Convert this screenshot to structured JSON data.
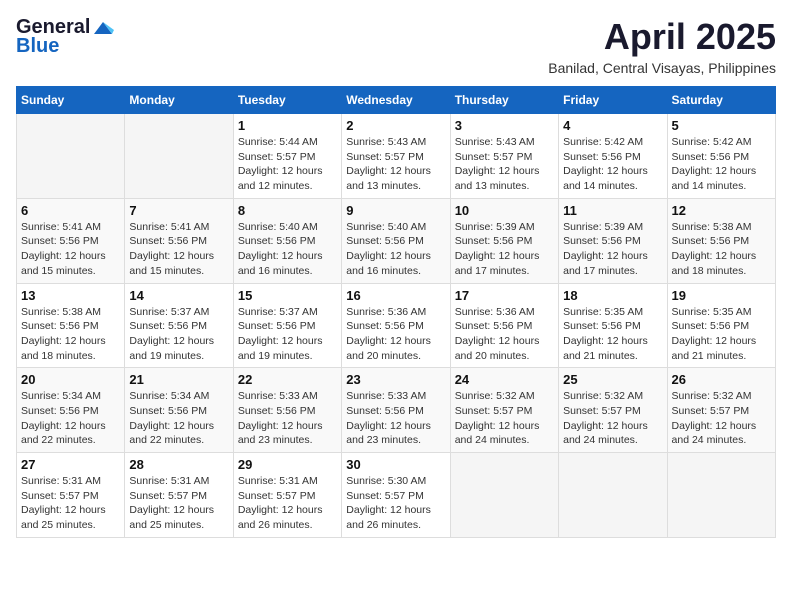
{
  "header": {
    "logo_general": "General",
    "logo_blue": "Blue",
    "month": "April 2025",
    "location": "Banilad, Central Visayas, Philippines"
  },
  "weekdays": [
    "Sunday",
    "Monday",
    "Tuesday",
    "Wednesday",
    "Thursday",
    "Friday",
    "Saturday"
  ],
  "weeks": [
    [
      {
        "day": "",
        "sunrise": "",
        "sunset": "",
        "daylight": ""
      },
      {
        "day": "",
        "sunrise": "",
        "sunset": "",
        "daylight": ""
      },
      {
        "day": "1",
        "sunrise": "Sunrise: 5:44 AM",
        "sunset": "Sunset: 5:57 PM",
        "daylight": "Daylight: 12 hours and 12 minutes."
      },
      {
        "day": "2",
        "sunrise": "Sunrise: 5:43 AM",
        "sunset": "Sunset: 5:57 PM",
        "daylight": "Daylight: 12 hours and 13 minutes."
      },
      {
        "day": "3",
        "sunrise": "Sunrise: 5:43 AM",
        "sunset": "Sunset: 5:57 PM",
        "daylight": "Daylight: 12 hours and 13 minutes."
      },
      {
        "day": "4",
        "sunrise": "Sunrise: 5:42 AM",
        "sunset": "Sunset: 5:56 PM",
        "daylight": "Daylight: 12 hours and 14 minutes."
      },
      {
        "day": "5",
        "sunrise": "Sunrise: 5:42 AM",
        "sunset": "Sunset: 5:56 PM",
        "daylight": "Daylight: 12 hours and 14 minutes."
      }
    ],
    [
      {
        "day": "6",
        "sunrise": "Sunrise: 5:41 AM",
        "sunset": "Sunset: 5:56 PM",
        "daylight": "Daylight: 12 hours and 15 minutes."
      },
      {
        "day": "7",
        "sunrise": "Sunrise: 5:41 AM",
        "sunset": "Sunset: 5:56 PM",
        "daylight": "Daylight: 12 hours and 15 minutes."
      },
      {
        "day": "8",
        "sunrise": "Sunrise: 5:40 AM",
        "sunset": "Sunset: 5:56 PM",
        "daylight": "Daylight: 12 hours and 16 minutes."
      },
      {
        "day": "9",
        "sunrise": "Sunrise: 5:40 AM",
        "sunset": "Sunset: 5:56 PM",
        "daylight": "Daylight: 12 hours and 16 minutes."
      },
      {
        "day": "10",
        "sunrise": "Sunrise: 5:39 AM",
        "sunset": "Sunset: 5:56 PM",
        "daylight": "Daylight: 12 hours and 17 minutes."
      },
      {
        "day": "11",
        "sunrise": "Sunrise: 5:39 AM",
        "sunset": "Sunset: 5:56 PM",
        "daylight": "Daylight: 12 hours and 17 minutes."
      },
      {
        "day": "12",
        "sunrise": "Sunrise: 5:38 AM",
        "sunset": "Sunset: 5:56 PM",
        "daylight": "Daylight: 12 hours and 18 minutes."
      }
    ],
    [
      {
        "day": "13",
        "sunrise": "Sunrise: 5:38 AM",
        "sunset": "Sunset: 5:56 PM",
        "daylight": "Daylight: 12 hours and 18 minutes."
      },
      {
        "day": "14",
        "sunrise": "Sunrise: 5:37 AM",
        "sunset": "Sunset: 5:56 PM",
        "daylight": "Daylight: 12 hours and 19 minutes."
      },
      {
        "day": "15",
        "sunrise": "Sunrise: 5:37 AM",
        "sunset": "Sunset: 5:56 PM",
        "daylight": "Daylight: 12 hours and 19 minutes."
      },
      {
        "day": "16",
        "sunrise": "Sunrise: 5:36 AM",
        "sunset": "Sunset: 5:56 PM",
        "daylight": "Daylight: 12 hours and 20 minutes."
      },
      {
        "day": "17",
        "sunrise": "Sunrise: 5:36 AM",
        "sunset": "Sunset: 5:56 PM",
        "daylight": "Daylight: 12 hours and 20 minutes."
      },
      {
        "day": "18",
        "sunrise": "Sunrise: 5:35 AM",
        "sunset": "Sunset: 5:56 PM",
        "daylight": "Daylight: 12 hours and 21 minutes."
      },
      {
        "day": "19",
        "sunrise": "Sunrise: 5:35 AM",
        "sunset": "Sunset: 5:56 PM",
        "daylight": "Daylight: 12 hours and 21 minutes."
      }
    ],
    [
      {
        "day": "20",
        "sunrise": "Sunrise: 5:34 AM",
        "sunset": "Sunset: 5:56 PM",
        "daylight": "Daylight: 12 hours and 22 minutes."
      },
      {
        "day": "21",
        "sunrise": "Sunrise: 5:34 AM",
        "sunset": "Sunset: 5:56 PM",
        "daylight": "Daylight: 12 hours and 22 minutes."
      },
      {
        "day": "22",
        "sunrise": "Sunrise: 5:33 AM",
        "sunset": "Sunset: 5:56 PM",
        "daylight": "Daylight: 12 hours and 23 minutes."
      },
      {
        "day": "23",
        "sunrise": "Sunrise: 5:33 AM",
        "sunset": "Sunset: 5:56 PM",
        "daylight": "Daylight: 12 hours and 23 minutes."
      },
      {
        "day": "24",
        "sunrise": "Sunrise: 5:32 AM",
        "sunset": "Sunset: 5:57 PM",
        "daylight": "Daylight: 12 hours and 24 minutes."
      },
      {
        "day": "25",
        "sunrise": "Sunrise: 5:32 AM",
        "sunset": "Sunset: 5:57 PM",
        "daylight": "Daylight: 12 hours and 24 minutes."
      },
      {
        "day": "26",
        "sunrise": "Sunrise: 5:32 AM",
        "sunset": "Sunset: 5:57 PM",
        "daylight": "Daylight: 12 hours and 24 minutes."
      }
    ],
    [
      {
        "day": "27",
        "sunrise": "Sunrise: 5:31 AM",
        "sunset": "Sunset: 5:57 PM",
        "daylight": "Daylight: 12 hours and 25 minutes."
      },
      {
        "day": "28",
        "sunrise": "Sunrise: 5:31 AM",
        "sunset": "Sunset: 5:57 PM",
        "daylight": "Daylight: 12 hours and 25 minutes."
      },
      {
        "day": "29",
        "sunrise": "Sunrise: 5:31 AM",
        "sunset": "Sunset: 5:57 PM",
        "daylight": "Daylight: 12 hours and 26 minutes."
      },
      {
        "day": "30",
        "sunrise": "Sunrise: 5:30 AM",
        "sunset": "Sunset: 5:57 PM",
        "daylight": "Daylight: 12 hours and 26 minutes."
      },
      {
        "day": "",
        "sunrise": "",
        "sunset": "",
        "daylight": ""
      },
      {
        "day": "",
        "sunrise": "",
        "sunset": "",
        "daylight": ""
      },
      {
        "day": "",
        "sunrise": "",
        "sunset": "",
        "daylight": ""
      }
    ]
  ]
}
